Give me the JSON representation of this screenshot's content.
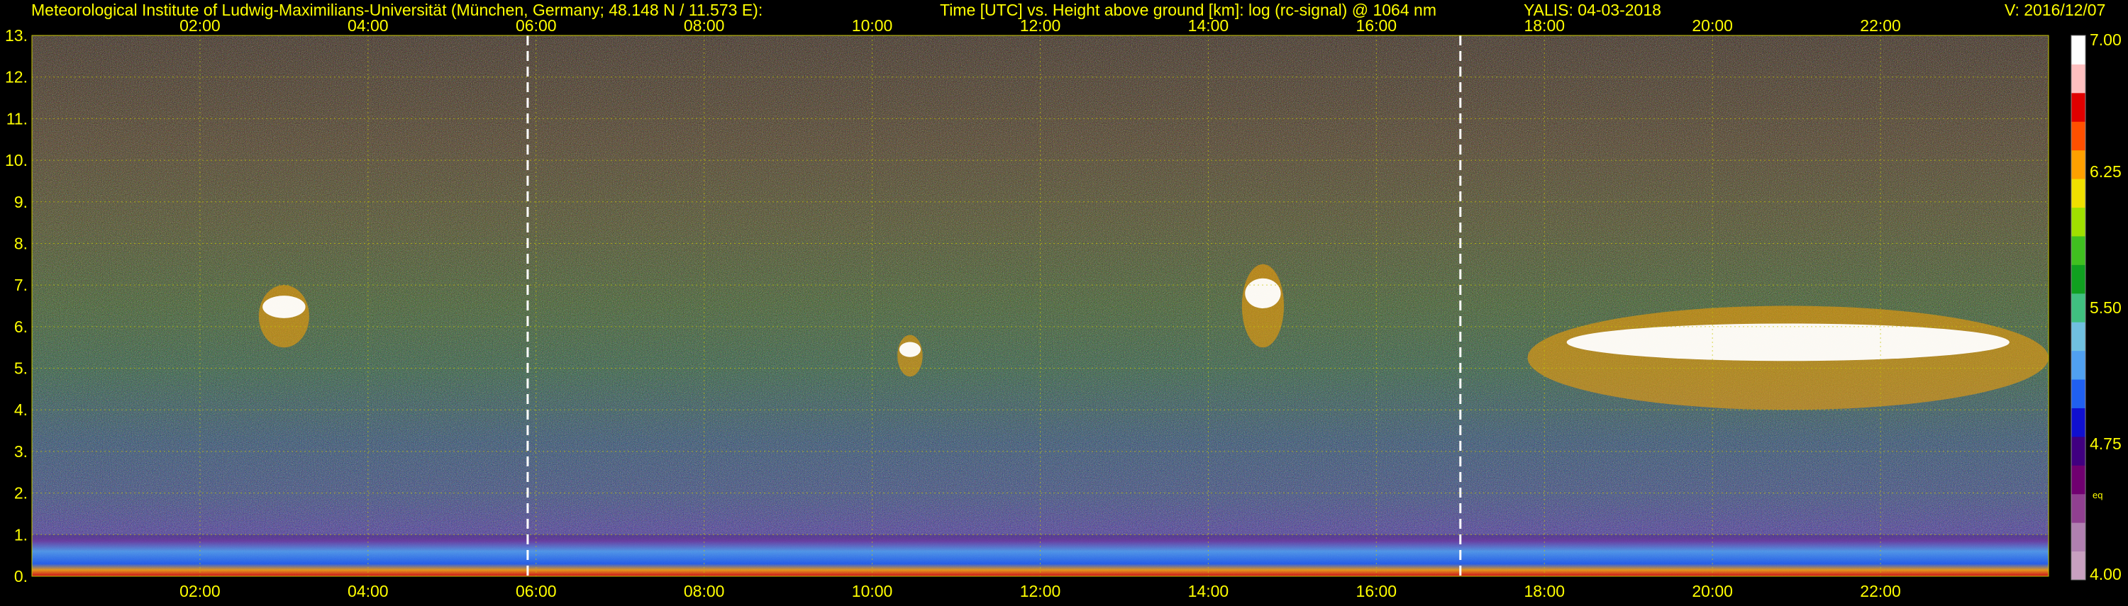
{
  "header": {
    "institute": "Meteorological Institute of Ludwig-Maximilians-Universität (München, Germany; 48.148 N / 11.573 E):",
    "title": "Time [UTC] vs. Height above ground [km]: log (rc-signal) @ 1064 nm",
    "instrument": "YALIS: 04-03-2018",
    "version": "V: 2016/12/07"
  },
  "chart_data": {
    "type": "heatmap",
    "title": "Time [UTC] vs. Height above ground [km]: log (rc-signal) @ 1064 nm",
    "x_range_hours": [
      0.0,
      24.0
    ],
    "x_ticks": [
      "02:00",
      "04:00",
      "06:00",
      "08:00",
      "10:00",
      "12:00",
      "14:00",
      "16:00",
      "18:00",
      "20:00",
      "22:00"
    ],
    "x_tick_hours": [
      2,
      4,
      6,
      8,
      10,
      12,
      14,
      16,
      18,
      20,
      22
    ],
    "y_range_km": [
      0,
      13
    ],
    "y_ticks": [
      "0.",
      "1.",
      "2.",
      "3.",
      "4.",
      "5.",
      "6.",
      "7.",
      "8.",
      "9.",
      "10.",
      "11.",
      "12.",
      "13."
    ],
    "y_tick_values": [
      0,
      1,
      2,
      3,
      4,
      5,
      6,
      7,
      8,
      9,
      10,
      11,
      12,
      13
    ],
    "grid": true,
    "dashed_markers_hours": [
      5.9,
      17.0
    ],
    "colorbar": {
      "range": [
        4.0,
        7.0
      ],
      "tick_labels": [
        "4.00",
        "4.75",
        "5.50",
        "6.25",
        "7.00"
      ],
      "tick_values": [
        4.0,
        4.75,
        5.5,
        6.25,
        7.0
      ],
      "note": "eq",
      "colors": [
        "#c8a0c0",
        "#b080b0",
        "#904090",
        "#700070",
        "#400080",
        "#1010d0",
        "#2060f0",
        "#50a0f0",
        "#70c0e0",
        "#40c080",
        "#10a020",
        "#40c020",
        "#a0e000",
        "#f0e000",
        "#ffa000",
        "#ff5000",
        "#e00000",
        "#ffc0c0",
        "#ffffff"
      ]
    },
    "features": [
      {
        "name": "boundary layer",
        "hours": [
          0.0,
          24.0
        ],
        "height_km": [
          0.0,
          1.0
        ],
        "level": 5.4
      },
      {
        "name": "cloud",
        "hours": [
          2.7,
          3.3
        ],
        "height_km": [
          5.5,
          7.0
        ],
        "level": 7.0
      },
      {
        "name": "cloud",
        "hours": [
          10.3,
          10.6
        ],
        "height_km": [
          4.8,
          5.8
        ],
        "level": 7.0
      },
      {
        "name": "cloud",
        "hours": [
          14.4,
          14.9
        ],
        "height_km": [
          5.5,
          7.5
        ],
        "level": 7.0
      },
      {
        "name": "cloud",
        "hours": [
          17.8,
          24.0
        ],
        "height_km": [
          4.0,
          6.5
        ],
        "level": 7.0
      }
    ]
  }
}
